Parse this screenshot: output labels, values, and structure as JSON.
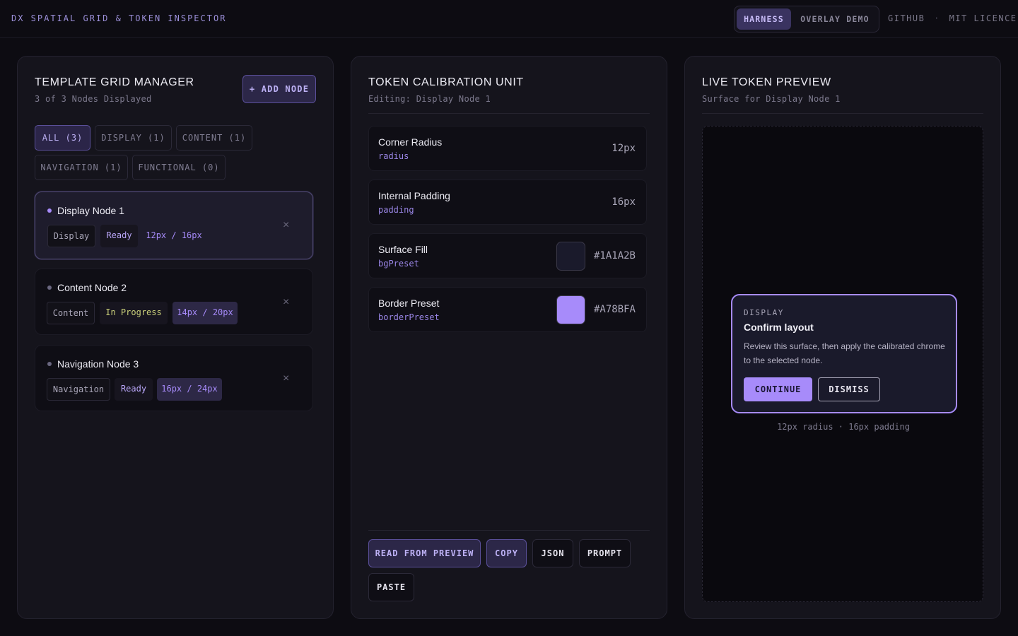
{
  "header": {
    "brand": "DX SPATIAL GRID & TOKEN INSPECTOR",
    "tabs": [
      "HARNESS",
      "OVERLAY DEMO"
    ],
    "active_tab": "HARNESS",
    "link_github": "GITHUB",
    "separator": "·",
    "link_licence": "MIT LICENCE"
  },
  "manager": {
    "title": "TEMPLATE GRID MANAGER",
    "subtitle": "3 of 3 Nodes Displayed",
    "add_button": "+ ADD NODE",
    "filters": [
      "ALL (3)",
      "DISPLAY (1)",
      "CONTENT (1)",
      "NAVIGATION (1)",
      "FUNCTIONAL (0)"
    ],
    "active_filter": "ALL (3)",
    "nodes": [
      {
        "title": "Display Node 1",
        "type": "Display",
        "status": "Ready",
        "size": "12px / 16px",
        "close": "×"
      },
      {
        "title": "Content Node 2",
        "type": "Content",
        "status": "In Progress",
        "size": "14px / 20px",
        "close": "×"
      },
      {
        "title": "Navigation Node 3",
        "type": "Navigation",
        "status": "Ready",
        "size": "16px / 24px",
        "close": "×"
      }
    ]
  },
  "calibration": {
    "title": "TOKEN CALIBRATION UNIT",
    "subtitle": "Editing: Display Node 1",
    "tokens": [
      {
        "label": "Corner Radius",
        "key": "radius",
        "value": "12px"
      },
      {
        "label": "Internal Padding",
        "key": "padding",
        "value": "16px"
      },
      {
        "label": "Surface Fill",
        "key": "bgPreset",
        "value": "#1A1A2B",
        "swatch": "#1A1A2B"
      },
      {
        "label": "Border Preset",
        "key": "borderPreset",
        "value": "#A78BFA",
        "swatch": "#A78BFA"
      }
    ],
    "actions": [
      "READ FROM PREVIEW",
      "COPY",
      "JSON",
      "PROMPT",
      "PASTE"
    ]
  },
  "preview": {
    "title": "LIVE TOKEN PREVIEW",
    "subtitle": "Surface for Display Node 1",
    "card": {
      "eyebrow": "DISPLAY",
      "title": "Confirm layout",
      "body": "Review this surface, then apply the calibrated chrome to the selected node.",
      "continue": "CONTINUE",
      "dismiss": "DISMISS"
    },
    "caption": "12px radius · 16px padding"
  },
  "colors": {
    "accent": "#A78BFA",
    "background": "#0D0C12",
    "panel": "#15141C",
    "progress": "#CAD07A"
  }
}
